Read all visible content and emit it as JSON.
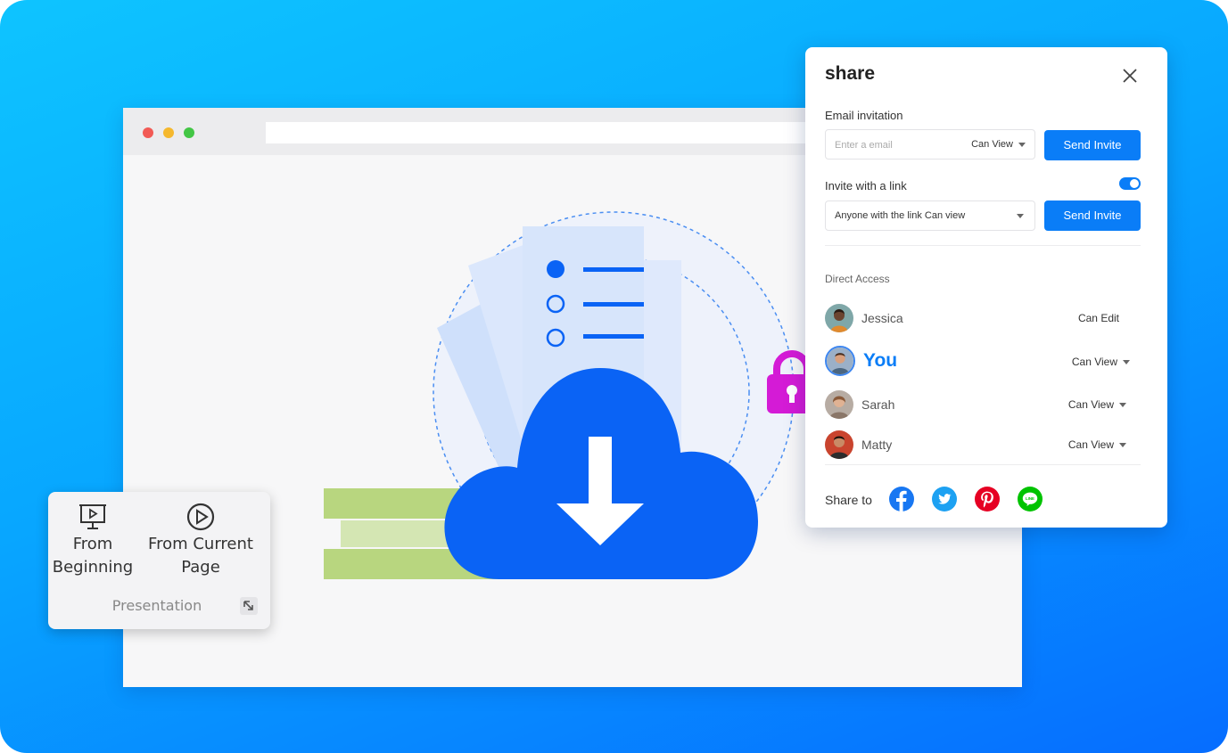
{
  "share_panel": {
    "title": "share",
    "email_invitation_label": "Email invitation",
    "email_placeholder": "Enter a email",
    "email_permission": "Can View",
    "send_invite_label": "Send Invite",
    "invite_link_label": "Invite with a link",
    "invite_link_enabled": true,
    "link_permission": "Anyone with the link Can view",
    "direct_access_label": "Direct Access",
    "people": [
      {
        "name": "Jessica",
        "permission": "Can Edit"
      },
      {
        "name": "You",
        "permission": "Can View"
      },
      {
        "name": "Sarah",
        "permission": "Can View"
      },
      {
        "name": "Matty",
        "permission": "Can View"
      }
    ],
    "share_to_label": "Share to",
    "social_icons": [
      "facebook-icon",
      "twitter-icon",
      "pinterest-icon",
      "line-icon"
    ]
  },
  "presentation_ribbon": {
    "from_beginning_line1": "From",
    "from_beginning_line2": "Beginning",
    "from_current_line1": "From Current",
    "from_current_line2": "Page",
    "group_label": "Presentation"
  },
  "colors": {
    "accent": "#0a7df7",
    "cloud": "#0a63f5",
    "lock": "#d41bd6",
    "facebook": "#1877f2",
    "twitter": "#1da1f2",
    "pinterest": "#e60023",
    "line": "#00c300"
  }
}
